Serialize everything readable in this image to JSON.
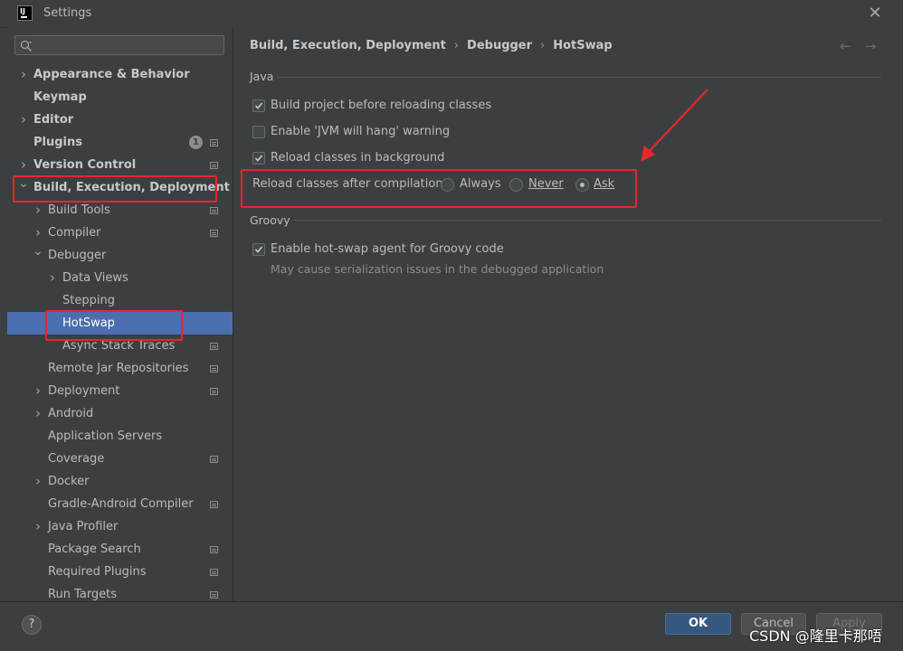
{
  "window": {
    "title": "Settings"
  },
  "sidebar": {
    "items": [
      {
        "label": "Appearance & Behavior",
        "bold": true,
        "level": 0,
        "chevron": "right",
        "project": false
      },
      {
        "label": "Keymap",
        "bold": true,
        "level": 0,
        "chevron": "",
        "project": false
      },
      {
        "label": "Editor",
        "bold": true,
        "level": 0,
        "chevron": "right",
        "project": false
      },
      {
        "label": "Plugins",
        "bold": true,
        "level": 0,
        "chevron": "",
        "project": true,
        "badge": "1"
      },
      {
        "label": "Version Control",
        "bold": true,
        "level": 0,
        "chevron": "right",
        "project": true
      },
      {
        "label": "Build, Execution, Deployment",
        "bold": true,
        "level": 0,
        "chevron": "down",
        "project": false
      },
      {
        "label": "Build Tools",
        "bold": false,
        "level": 1,
        "chevron": "right",
        "project": true
      },
      {
        "label": "Compiler",
        "bold": false,
        "level": 1,
        "chevron": "right",
        "project": true
      },
      {
        "label": "Debugger",
        "bold": false,
        "level": 1,
        "chevron": "down",
        "project": false
      },
      {
        "label": "Data Views",
        "bold": false,
        "level": 2,
        "chevron": "right",
        "project": false
      },
      {
        "label": "Stepping",
        "bold": false,
        "level": 2,
        "chevron": "",
        "project": false
      },
      {
        "label": "HotSwap",
        "bold": false,
        "level": 2,
        "chevron": "",
        "project": false,
        "selected": true
      },
      {
        "label": "Async Stack Traces",
        "bold": false,
        "level": 2,
        "chevron": "",
        "project": true
      },
      {
        "label": "Remote Jar Repositories",
        "bold": false,
        "level": 1,
        "chevron": "",
        "project": true
      },
      {
        "label": "Deployment",
        "bold": false,
        "level": 1,
        "chevron": "right",
        "project": true
      },
      {
        "label": "Android",
        "bold": false,
        "level": 1,
        "chevron": "right",
        "project": false
      },
      {
        "label": "Application Servers",
        "bold": false,
        "level": 1,
        "chevron": "",
        "project": false
      },
      {
        "label": "Coverage",
        "bold": false,
        "level": 1,
        "chevron": "",
        "project": true
      },
      {
        "label": "Docker",
        "bold": false,
        "level": 1,
        "chevron": "right",
        "project": false
      },
      {
        "label": "Gradle-Android Compiler",
        "bold": false,
        "level": 1,
        "chevron": "",
        "project": true
      },
      {
        "label": "Java Profiler",
        "bold": false,
        "level": 1,
        "chevron": "right",
        "project": false
      },
      {
        "label": "Package Search",
        "bold": false,
        "level": 1,
        "chevron": "",
        "project": true
      },
      {
        "label": "Required Plugins",
        "bold": false,
        "level": 1,
        "chevron": "",
        "project": true
      },
      {
        "label": "Run Targets",
        "bold": false,
        "level": 1,
        "chevron": "",
        "project": true
      }
    ]
  },
  "breadcrumb": [
    "Build, Execution, Deployment",
    "Debugger",
    "HotSwap"
  ],
  "java": {
    "title": "Java",
    "build_before_reload": {
      "label": "Build project before reloading classes",
      "checked": true
    },
    "jvm_hang_warning": {
      "label": "Enable 'JVM will hang' warning",
      "checked": false
    },
    "reload_background": {
      "label": "Reload classes in background",
      "checked": true
    },
    "reload_after_compilation": {
      "label": "Reload classes after compilation:",
      "options": [
        "Always",
        "Never",
        "Ask"
      ],
      "selected": "Ask"
    }
  },
  "groovy": {
    "title": "Groovy",
    "hotswap_agent": {
      "label": "Enable hot-swap agent for Groovy code",
      "checked": true
    },
    "hint": "May cause serialization issues in the debugged application"
  },
  "footer": {
    "help": "?",
    "ok": "OK",
    "cancel": "Cancel",
    "apply": "Apply"
  },
  "watermark": "CSDN @隆里卡那唔",
  "colors": {
    "selection": "#4b6eaf",
    "annotation": "#e8262b",
    "ok_button": "#365880"
  }
}
